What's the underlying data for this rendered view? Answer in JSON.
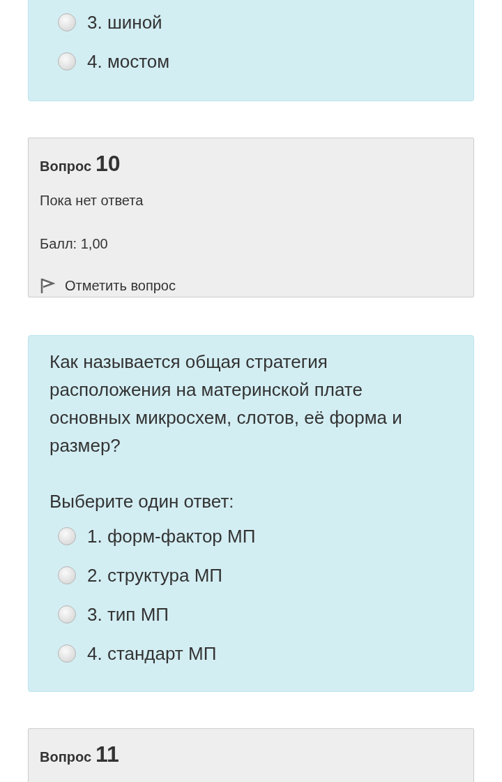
{
  "previous_question": {
    "options": [
      {
        "label": "3. шиной",
        "selected": false
      },
      {
        "label": "4. мостом",
        "selected": false
      }
    ]
  },
  "question_info": {
    "label": "Вопрос",
    "number": "10",
    "status": "Пока нет ответа",
    "score": "Балл: 1,00",
    "flag_label": "Отметить вопрос"
  },
  "question": {
    "text": "Как называется общая стратегия расположения на материнской плате основных микросхем, слотов, её форма и размер?",
    "prompt": "Выберите один ответ:",
    "options": [
      {
        "label": "1. форм-фактор МП",
        "selected": false
      },
      {
        "label": "2. структура МП",
        "selected": false
      },
      {
        "label": "3. тип МП",
        "selected": false
      },
      {
        "label": "4. стандарт МП",
        "selected": false
      }
    ]
  },
  "next_question_info": {
    "label": "Вопрос",
    "number": "11"
  }
}
